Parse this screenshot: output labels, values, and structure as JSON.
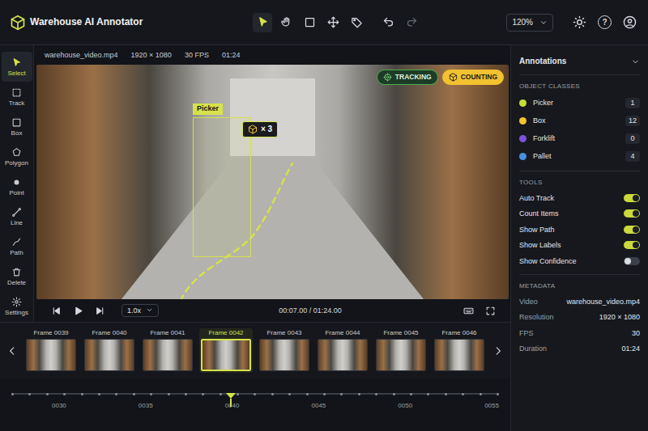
{
  "app": {
    "title": "Warehouse AI Annotator",
    "zoom": "120%",
    "help": "?"
  },
  "top_tools": [
    {
      "kind": "pointer",
      "selected": true
    },
    {
      "kind": "hand",
      "selected": false
    },
    {
      "kind": "box",
      "selected": false
    },
    {
      "kind": "move",
      "selected": false
    },
    {
      "kind": "tag",
      "selected": false
    }
  ],
  "history": [
    {
      "kind": "undo",
      "disabled": false
    },
    {
      "kind": "redo",
      "disabled": true
    }
  ],
  "side_tools": [
    {
      "label": "Select",
      "kind": "select",
      "selected": true
    },
    {
      "label": "Track",
      "kind": "track",
      "selected": false
    },
    {
      "label": "Box",
      "kind": "box",
      "selected": false
    },
    {
      "label": "Polygon",
      "kind": "polygon",
      "selected": false
    },
    {
      "label": "Point",
      "kind": "point",
      "selected": false
    },
    {
      "label": "Line",
      "kind": "line",
      "selected": false
    },
    {
      "label": "Path",
      "kind": "path",
      "selected": false
    },
    {
      "label": "Delete",
      "kind": "delete",
      "selected": false
    },
    {
      "label": "Settings",
      "kind": "settings",
      "selected": false
    }
  ],
  "video": {
    "file": "warehouse_video.mp4",
    "resolution": "1920 × 1080",
    "fps": "30 FPS",
    "duration": "01:24"
  },
  "overlay": {
    "badges": [
      {
        "label": "TRACKING",
        "kind": "tracking"
      },
      {
        "label": "COUNTING",
        "kind": "counting"
      }
    ],
    "object": {
      "label": "Picker",
      "count": "× 3"
    }
  },
  "player": {
    "speed": "1.0x",
    "time": "00:07.00 / 01:24.00",
    "playing": false
  },
  "filmstrip": {
    "frames": [
      {
        "label": "Frame 0039",
        "selected": false
      },
      {
        "label": "Frame 0040",
        "selected": false
      },
      {
        "label": "Frame 0041",
        "selected": false
      },
      {
        "label": "Frame 0042",
        "selected": true
      },
      {
        "label": "Frame 0043",
        "selected": false
      },
      {
        "label": "Frame 0044",
        "selected": false
      },
      {
        "label": "Frame 0045",
        "selected": false
      },
      {
        "label": "Frame 0046",
        "selected": false
      }
    ]
  },
  "timeline": {
    "ticks": [
      "0030",
      "0035",
      "0040",
      "0045",
      "0050",
      "0055"
    ],
    "level": 0.45
  },
  "panel": {
    "title": "Annotations",
    "classes_title": "OBJECT CLASSES",
    "classes": [
      {
        "name": "Picker",
        "count": "1",
        "color": "#c5dc3a"
      },
      {
        "name": "Box",
        "count": "12",
        "color": "#f2c230"
      },
      {
        "name": "Forklift",
        "count": "0",
        "color": "#7b52d9"
      },
      {
        "name": "Pallet",
        "count": "4",
        "color": "#4a90e2"
      }
    ],
    "tools_title": "TOOLS",
    "tools": [
      {
        "name": "Auto Track",
        "on": true
      },
      {
        "name": "Count Items",
        "on": true
      },
      {
        "name": "Show Path",
        "on": true
      },
      {
        "name": "Show Labels",
        "on": true
      },
      {
        "name": "Show Confidence",
        "on": false
      }
    ],
    "metadata_title": "METADATA",
    "metadata": [
      {
        "key": "Video",
        "value": "warehouse_video.mp4"
      },
      {
        "key": "Resolution",
        "value": "1920 × 1080"
      },
      {
        "key": "FPS",
        "value": "30"
      },
      {
        "key": "Duration",
        "value": "01:24"
      }
    ]
  }
}
